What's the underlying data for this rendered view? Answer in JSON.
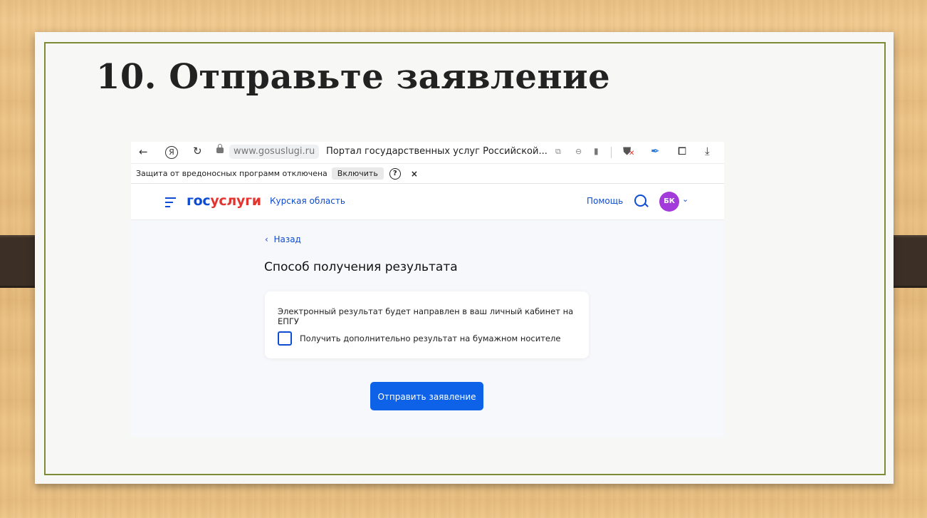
{
  "slide": {
    "title": "10. Отправьте заявление"
  },
  "browser": {
    "url": "www.gosuslugi.ru",
    "page_title": "Портал государственных услуг Российской...",
    "icons": [
      "back-arrow-icon",
      "yandex-icon",
      "reload-icon",
      "lock-icon",
      "translate-icon",
      "zoom-icon",
      "bookmark-icon",
      "shield-blocked-icon",
      "feather-icon",
      "extensions-icon",
      "download-icon"
    ]
  },
  "security_bar": {
    "text": "Защита от вредоносных программ отключена",
    "enable_label": "Включить",
    "help_label": "?",
    "close_label": "×"
  },
  "header": {
    "logo_part1": "гос",
    "logo_part2": "услуги",
    "region": "Курская область",
    "help": "Помощь",
    "avatar_initials": "БК"
  },
  "main": {
    "back_label": "Назад",
    "heading": "Способ получения результата",
    "info_text": "Электронный результат будет направлен в ваш личный кабинет на ЕПГУ",
    "checkbox_label": "Получить дополнительно результат на бумажном носителе",
    "checkbox_checked": false,
    "submit_label": "Отправить заявление"
  },
  "colors": {
    "accent": "#0d4cd3",
    "button": "#0d62e8",
    "logo_red": "#e2352f",
    "avatar": "#a23bd9",
    "frame": "#7f8b34"
  }
}
